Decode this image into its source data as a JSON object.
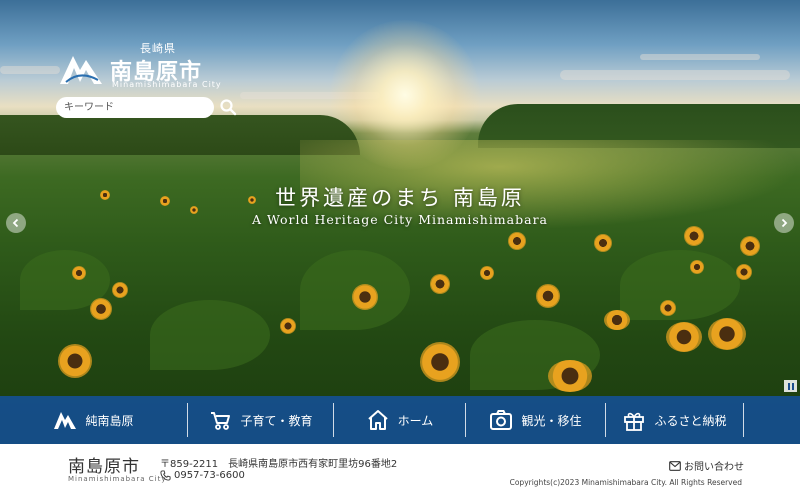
{
  "logo": {
    "prefecture": "長崎県",
    "name": "南島原市",
    "roman": "Minamishimabara City"
  },
  "search": {
    "placeholder": "キーワード",
    "icon": "search-icon"
  },
  "hero": {
    "title_jp": "世界遺産のまち 南島原",
    "title_en": "A World Heritage City Minamishimabara"
  },
  "slider": {
    "prev_icon": "chevron-left-icon",
    "next_icon": "chevron-right-icon",
    "pause_icon": "pause-icon"
  },
  "nav": {
    "items": [
      {
        "label": "純南島原",
        "icon": "city-logo-icon"
      },
      {
        "label": "子育て・教育",
        "icon": "stroller-icon"
      },
      {
        "label": "ホーム",
        "icon": "home-icon"
      },
      {
        "label": "観光・移住",
        "icon": "camera-icon"
      },
      {
        "label": "ふるさと納税",
        "icon": "gift-icon"
      }
    ]
  },
  "footer": {
    "name": "南島原市",
    "roman": "Minamishimabara City",
    "address": "〒859-2211　長崎県南島原市西有家町里坊96番地2",
    "tel": "0957-73-6600",
    "contact": "お問い合わせ",
    "copyright": "Copyrights(c)2023 Minamishimabara City. All Rights Reserved"
  },
  "colors": {
    "nav_bg": "#1450963",
    "text_dark": "#333333"
  }
}
